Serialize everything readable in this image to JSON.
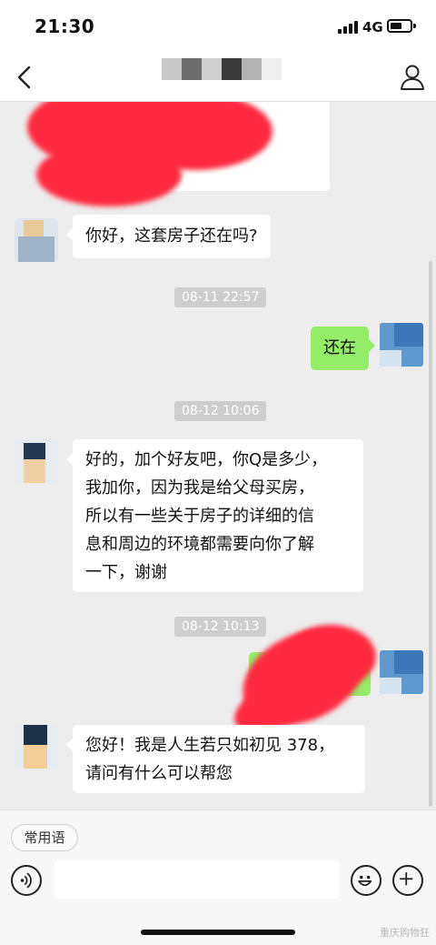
{
  "status_bar": {
    "time": "21:30",
    "network": "4G"
  },
  "nav": {
    "title": ""
  },
  "messages": {
    "m1": "你好，这套房子还在吗?",
    "t1": "08-11 22:57",
    "m2": "还在",
    "t2": "08-12 10:06",
    "m3": [
      "好的，加个好友吧，你Q是多少，",
      "我加你，因为我是给父母买房，",
      "所以有一些关于房子的详细的信",
      "息和周边的环境都需要向你了解",
      "一下，谢谢"
    ],
    "t3": "08-12 10:13",
    "m4": [
      "您好！我是人生若只如初见 378，",
      "请问有什么可以帮您"
    ]
  },
  "input_bar": {
    "phrase_label": "常用语",
    "input_value": ""
  },
  "watermark": "重庆购物狂",
  "colors": {
    "sent_bubble": "#95ec69",
    "received_bubble": "#ffffff",
    "chat_bg": "#ededed",
    "redaction": "#ff2a40"
  },
  "icons": [
    "back-arrow-icon",
    "profile-icon",
    "voice-icon",
    "emoji-icon",
    "plus-icon"
  ]
}
